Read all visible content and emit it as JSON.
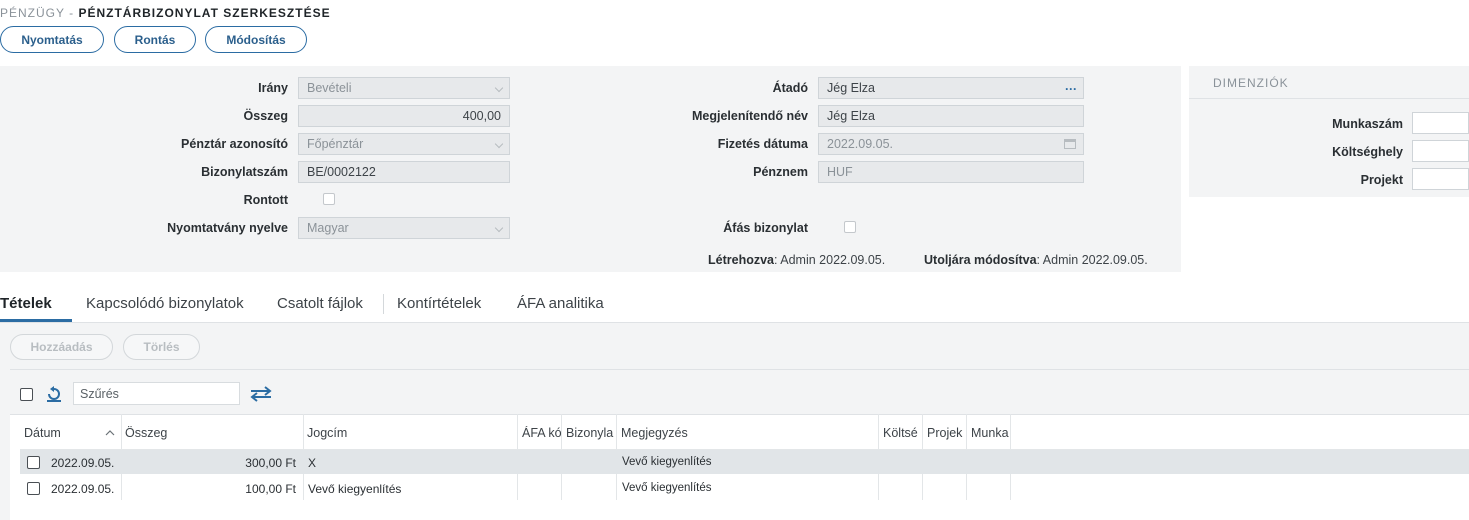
{
  "header": {
    "breadcrumb_parent": "PÉNZÜGY -",
    "title": "PÉNZTÁRBIZONYLAT SZERKESZTÉSE",
    "buttons": [
      "Nyomtatás",
      "Rontás",
      "Módosítás"
    ]
  },
  "form": {
    "irany_label": "Irány",
    "irany_value": "Bevételi",
    "osszeg_label": "Összeg",
    "osszeg_value": "400,00",
    "penztar_label": "Pénztár azonosító",
    "penztar_value": "Főpénztár",
    "bizonylatszam_label": "Bizonylatszám",
    "bizonylatszam_value": "BE/0002122",
    "rontott_label": "Rontott",
    "nyelv_label": "Nyomtatvány nyelve",
    "nyelv_value": "Magyar",
    "atado_label": "Átadó",
    "atado_value": "Jég Elza",
    "megjelenitendo_label": "Megjelenítendő név",
    "megjelenitendo_value": "Jég Elza",
    "fizetes_label": "Fizetés dátuma",
    "fizetes_value": "2022.09.05.",
    "penznem_label": "Pénznem",
    "penznem_value": "HUF",
    "afas_label": "Áfás bizonylat",
    "letrehozva_label": "Létrehozva",
    "letrehozva_value": ": Admin 2022.09.05.",
    "modositva_label": "Utoljára módosítva",
    "modositva_value": ": Admin 2022.09.05."
  },
  "dimensions": {
    "title": "DIMENZIÓK",
    "munkaszam_label": "Munkaszám",
    "koltseghely_label": "Költséghely",
    "projekt_label": "Projekt"
  },
  "tabs": [
    "Tételek",
    "Kapcsolódó bizonylatok",
    "Csatolt fájlok",
    "Kontírtételek",
    "ÁFA analitika"
  ],
  "toolbar": {
    "add_label": "Hozzáadás",
    "delete_label": "Törlés",
    "filter_placeholder": "Szűrés"
  },
  "grid": {
    "columns": [
      "Dátum",
      "Összeg",
      "Jogcím",
      "ÁFA kó",
      "Bizonyla",
      "Megjegyzés",
      "Költsé",
      "Projek",
      "Munka"
    ],
    "rows": [
      {
        "datum": "2022.09.05.",
        "osszeg": "300,00 Ft",
        "jogcim": "X",
        "megjegyzes": "Vevő kiegyenlítés"
      },
      {
        "datum": "2022.09.05.",
        "osszeg": "100,00 Ft",
        "jogcim": "Vevő kiegyenlítés",
        "megjegyzes": "Vevő kiegyenlítés"
      }
    ]
  },
  "colors": {
    "accent": "#2b6ca3",
    "panel_bg": "#f3f4f5",
    "selected_row": "#e1e5e8"
  }
}
